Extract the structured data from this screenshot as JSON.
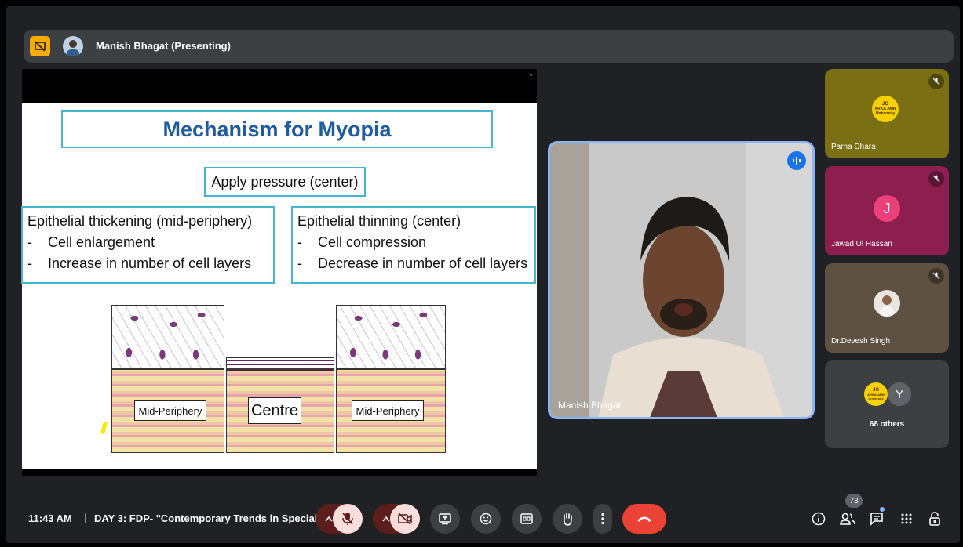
{
  "header": {
    "presenter": "Manish Bhagat (Presenting)"
  },
  "slide": {
    "title": "Mechanism for Myopia",
    "apply": "Apply pressure (center)",
    "left_heading": "Epithelial thickening (mid-periphery)",
    "left_items": [
      "Cell enlargement",
      "Increase in number of cell layers"
    ],
    "right_heading": "Epithelial thinning (center)",
    "right_items": [
      "Cell compression",
      "Decrease in number of cell layers"
    ],
    "dash": "-",
    "labels": {
      "left": "Mid-Periphery",
      "center": "Centre",
      "right": "Mid-Periphery"
    }
  },
  "main_video": {
    "name": "Manish Bhagat"
  },
  "participants": [
    {
      "name": "Parna Dhara",
      "bg": "#7a6f13"
    },
    {
      "name": "Jawad Ul Hassan",
      "bg": "#8c1f4d",
      "initial": "J"
    },
    {
      "name": "Dr.Devesh Singh",
      "bg": "#5e5142"
    }
  ],
  "org_logo": {
    "line1": "ARKA JAIN",
    "line2": "University",
    "mark": "JG"
  },
  "others": {
    "initial": "Y",
    "label": "68 others"
  },
  "bottom": {
    "time": "11:43 AM",
    "separator": "|",
    "meeting_title": "DAY 3: FDP- \"Contemporary Trends in Special...",
    "people_count": "73"
  },
  "colors": {
    "accent": "#8ab4f8",
    "leave": "#ea4335",
    "muted_bg": "#f9dedc",
    "muted_dark": "#5c1e1c"
  }
}
